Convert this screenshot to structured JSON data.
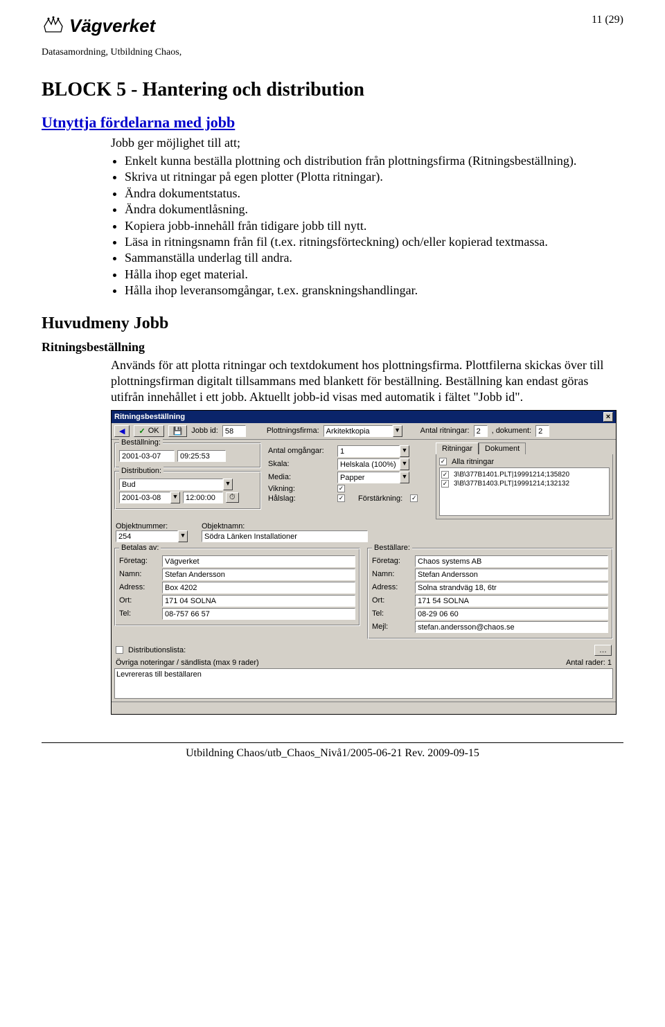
{
  "header": {
    "brand": "Vägverket",
    "page_number": "11 (29)",
    "subheader": "Datasamordning, Utbildning Chaos,"
  },
  "block_title": "BLOCK 5 - Hantering och distribution",
  "section1_title": "Utnyttja fördelarna med jobb",
  "intro_line": "Jobb ger möjlighet till att;",
  "bullets": [
    "Enkelt kunna beställa plottning och distribution från plottningsfirma (Ritningsbeställning).",
    "Skriva ut ritningar på egen plotter (Plotta ritningar).",
    "Ändra dokumentstatus.",
    "Ändra dokumentlåsning.",
    "Kopiera jobb-innehåll från tidigare jobb till nytt.",
    "Läsa in ritningsnamn från fil (t.ex. ritningsförteckning) och/eller kopierad textmassa.",
    "Sammanställa underlag till andra.",
    "Hålla ihop eget material.",
    "Hålla ihop leveransomgångar, t.ex. granskningshandlingar."
  ],
  "huvudmeny_title": "Huvudmeny Jobb",
  "ritn_title": "Ritningsbeställning",
  "ritn_body": "Används för att plotta ritningar och textdokument hos plottningsfirma. Plottfilerna skickas över till plottningsfirman digitalt tillsammans med blankett för beställning. Beställning kan endast göras utifrån innehållet i ett jobb. Aktuellt jobb-id visas med automatik i fältet \"Jobb id\".",
  "dlg": {
    "title": "Ritningsbeställning",
    "ok_label": "OK",
    "jobb_id_label": "Jobb id:",
    "jobb_id": "58",
    "plottningsfirma_label": "Plottningsfirma:",
    "plottningsfirma": "Arkitektkopia",
    "antal_ritningar_label": "Antal ritningar:",
    "antal_ritningar": "2",
    "dokument_label": ", dokument:",
    "dokument": "2",
    "bestallning_group": "Beställning:",
    "bestallning_date": "2001-03-07",
    "bestallning_time": "09:25:53",
    "distribution_group": "Distribution:",
    "distribution_method": "Bud",
    "distribution_date": "2001-03-08",
    "distribution_time": "12:00:00",
    "antal_omgangar_label": "Antal omgångar:",
    "antal_omgangar": "1",
    "skala_label": "Skala:",
    "skala": "Helskala (100%)",
    "media_label": "Media:",
    "media": "Papper",
    "vikning_label": "Vikning:",
    "halslag_label": "Hålslag:",
    "forstarkning_label": "Förstärkning:",
    "tab_ritningar": "Ritningar",
    "tab_dokument": "Dokument",
    "alla_ritningar": "Alla ritningar",
    "list_item1": "3\\B\\377B1401.PLT|19991214;135820",
    "list_item2": "3\\B\\377B1403.PLT|19991214;132132",
    "objektnummer_label": "Objektnummer:",
    "objektnummer": "254",
    "objektnamn_label": "Objektnamn:",
    "objektnamn": "Södra Länken Installationer",
    "betalas_group": "Betalas av:",
    "bestallare_group": "Beställare:",
    "foretag_label": "Företag:",
    "namn_label": "Namn:",
    "adress_label": "Adress:",
    "ort_label": "Ort:",
    "tel_label": "Tel:",
    "mejl_label": "Mejl:",
    "betalas": {
      "foretag": "Vägverket",
      "namn": "Stefan Andersson",
      "adress": "Box 4202",
      "ort": "171 04  SOLNA",
      "tel": "08-757 66 57"
    },
    "bestallare": {
      "foretag": "Chaos systems AB",
      "namn": "Stefan Andersson",
      "adress": "Solna strandväg 18, 6tr",
      "ort": "171 54  SOLNA",
      "tel": "08-29 06 60",
      "mejl": "stefan.andersson@chaos.se"
    },
    "distributionslista_label": "Distributionslista:",
    "ovriga_label": "Övriga noteringar / sändlista (max 9 rader)",
    "antal_rader_label": "Antal rader: 1",
    "ovriga_text": "Levrereras till beställaren"
  },
  "footer": "Utbildning Chaos/utb_Chaos_Nivå1/2005-06-21 Rev. 2009-09-15"
}
